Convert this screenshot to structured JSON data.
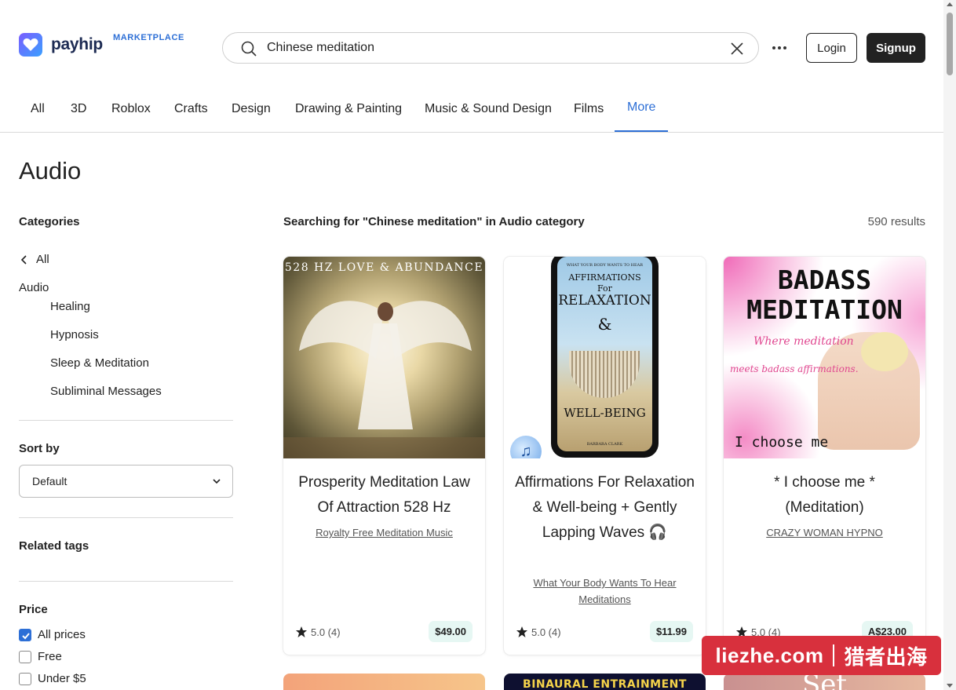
{
  "header": {
    "logo_text": "payhip",
    "marketplace_label": "MARKETPLACE",
    "search_value": "Chinese meditation",
    "login_label": "Login",
    "signup_label": "Signup"
  },
  "nav": {
    "tabs": [
      {
        "label": "All"
      },
      {
        "label": "3D"
      },
      {
        "label": "Roblox"
      },
      {
        "label": "Crafts"
      },
      {
        "label": "Design"
      },
      {
        "label": "Drawing & Painting"
      },
      {
        "label": "Music & Sound Design"
      },
      {
        "label": "Films"
      },
      {
        "label": "More",
        "active": true
      }
    ]
  },
  "sidebar": {
    "page_title": "Audio",
    "categories_heading": "Categories",
    "back_all": "All",
    "current_category": "Audio",
    "subcategories": [
      "Healing",
      "Hypnosis",
      "Sleep & Meditation",
      "Subliminal Messages"
    ],
    "sort_heading": "Sort by",
    "sort_value": "Default",
    "tags_heading": "Related tags",
    "price_heading": "Price",
    "price_options": [
      {
        "label": "All prices",
        "checked": true
      },
      {
        "label": "Free",
        "checked": false
      },
      {
        "label": "Under $5",
        "checked": false
      }
    ]
  },
  "results": {
    "heading": "Searching for \"Chinese meditation\" in Audio category",
    "count": "590 results",
    "products": [
      {
        "cover_text": "528 HZ LOVE & ABUNDANCE",
        "title": "Prosperity Meditation Law Of Attraction 528 Hz",
        "creator": "Royalty Free Meditation Music",
        "rating": "5.0 (4)",
        "price": "$49.00"
      },
      {
        "cover_lines": [
          "WHAT YOUR BODY WANTS TO HEAR",
          "AFFIRMATIONS",
          "For",
          "RELAXATION",
          "&",
          "WELL-BEING",
          "BARBARA CLARK"
        ],
        "title": "Affirmations For Relaxation & Well-being + Gently Lapping Waves 🎧",
        "creator": "What Your Body Wants To Hear Meditations",
        "rating": "5.0 (4)",
        "price": "$11.99"
      },
      {
        "cover_lines": [
          "BADASS",
          "MEDITATION",
          "Where meditation",
          "meets badass affirmations.",
          "I choose me"
        ],
        "title": "* I choose me * (Meditation)",
        "creator": "CRAZY WOMAN HYPNO",
        "rating": "5.0 (4)",
        "price": "A$23.00"
      }
    ],
    "row2_cover_text": [
      "BINAURAL ENTRAINMENT",
      "Set"
    ]
  },
  "watermark": {
    "left": "liezhe.com",
    "right": "猎者出海"
  },
  "colors": {
    "accent": "#2d6fd6",
    "price_bg": "#e6f7f3",
    "watermark": "#d8303d"
  }
}
